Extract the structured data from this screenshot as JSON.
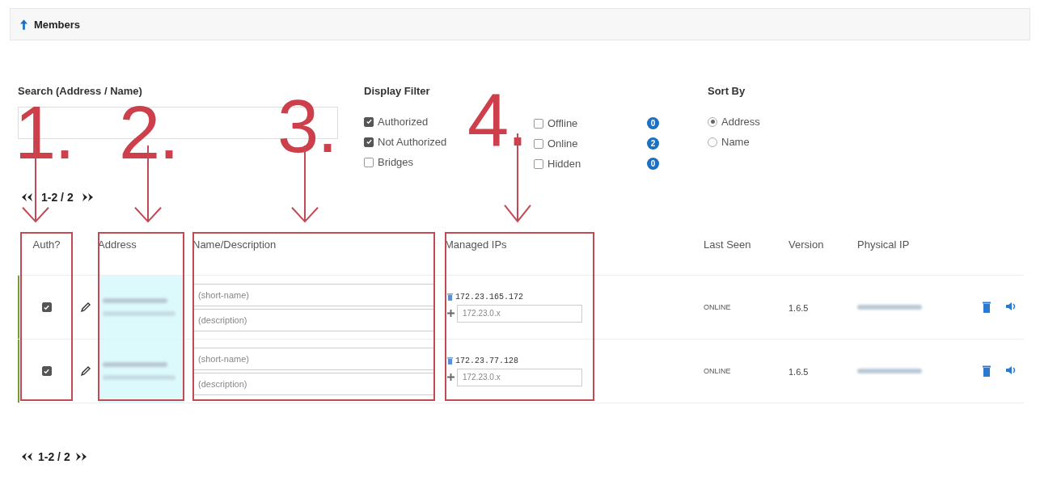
{
  "header": {
    "title": "Members"
  },
  "search": {
    "label": "Search (Address / Name)"
  },
  "display_filter": {
    "title": "Display Filter",
    "options": [
      {
        "label": "Authorized",
        "checked": true
      },
      {
        "label": "Not Authorized",
        "checked": true
      },
      {
        "label": "Bridges",
        "checked": false
      }
    ],
    "status_options": [
      {
        "label": "Offline",
        "checked": false,
        "count": "0"
      },
      {
        "label": "Online",
        "checked": false,
        "count": "2"
      },
      {
        "label": "Hidden",
        "checked": false,
        "count": "0"
      }
    ]
  },
  "sort_by": {
    "title": "Sort By",
    "options": [
      {
        "label": "Address",
        "selected": true
      },
      {
        "label": "Name",
        "selected": false
      }
    ]
  },
  "pagination_top": "1-2 / 2",
  "table": {
    "columns": [
      "Auth?",
      "Address",
      "Name/Description",
      "Managed IPs",
      "Last Seen",
      "Version",
      "Physical IP"
    ],
    "rows": [
      {
        "authorized": true,
        "short_name_placeholder": "(short-name)",
        "description_placeholder": "(description)",
        "managed_ip": "172.23.165.172",
        "new_ip_placeholder": "172.23.0.x",
        "last_seen": "ONLINE",
        "version": "1.6.5"
      },
      {
        "authorized": true,
        "short_name_placeholder": "(short-name)",
        "description_placeholder": "(description)",
        "managed_ip": "172.23.77.128",
        "new_ip_placeholder": "172.23.0.x",
        "last_seen": "ONLINE",
        "version": "1.6.5"
      }
    ]
  },
  "pagination_bottom": "1-2 / 2",
  "annotations": [
    {
      "label": "1."
    },
    {
      "label": "2."
    },
    {
      "label": "3."
    },
    {
      "label": "4."
    }
  ]
}
